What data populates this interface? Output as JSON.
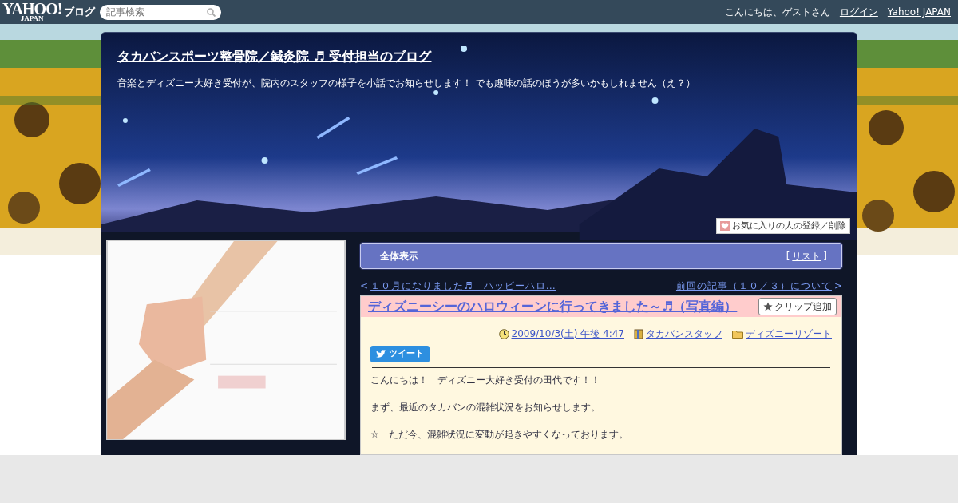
{
  "top_bar": {
    "logo": {
      "brand": "YAHOO!",
      "sub": "JAPAN",
      "service": "ブログ"
    },
    "search": {
      "placeholder": "記事検索"
    },
    "greeting": "こんにちは、ゲストさん",
    "links": [
      "ログイン",
      "Yahoo! JAPAN"
    ]
  },
  "blog_header": {
    "title": "タカバンスポーツ整骨院／鍼灸院 ♬ 受付担当のブログ",
    "description": "音楽とディズニー大好き受付が、院内のスタッフの様子を小話でお知らせします！ でも趣味の話のほうが多いかもしれません（え？）",
    "favorite_button": "お気に入りの人の登録／削除"
  },
  "view_bar": {
    "label": "全体表示",
    "list_open": "[",
    "list_link": "リスト",
    "list_close": "]"
  },
  "article_nav": {
    "prev_arrow": "<",
    "prev": "１０月になりました♬　ハッピーハロ…",
    "next": "前回の記事（１０／３）について",
    "next_arrow": ">"
  },
  "article": {
    "title": "ディズニーシーのハロウィーンに行ってきました～♬（写真編）",
    "clip_button": "クリップ追加",
    "date": "2009/10/3(土) 午後 4:47",
    "author": "タカバンスタッフ",
    "category": "ディズニーリゾート",
    "tweet_button": "ツイート",
    "paragraphs": [
      "こんにちは！　ディズニー大好き受付の田代です！！",
      "まず、最近のタカバンの混雑状況をお知らせします。",
      "☆　ただ今、混雑状況に変動が起きやすくなっております。"
    ]
  }
}
